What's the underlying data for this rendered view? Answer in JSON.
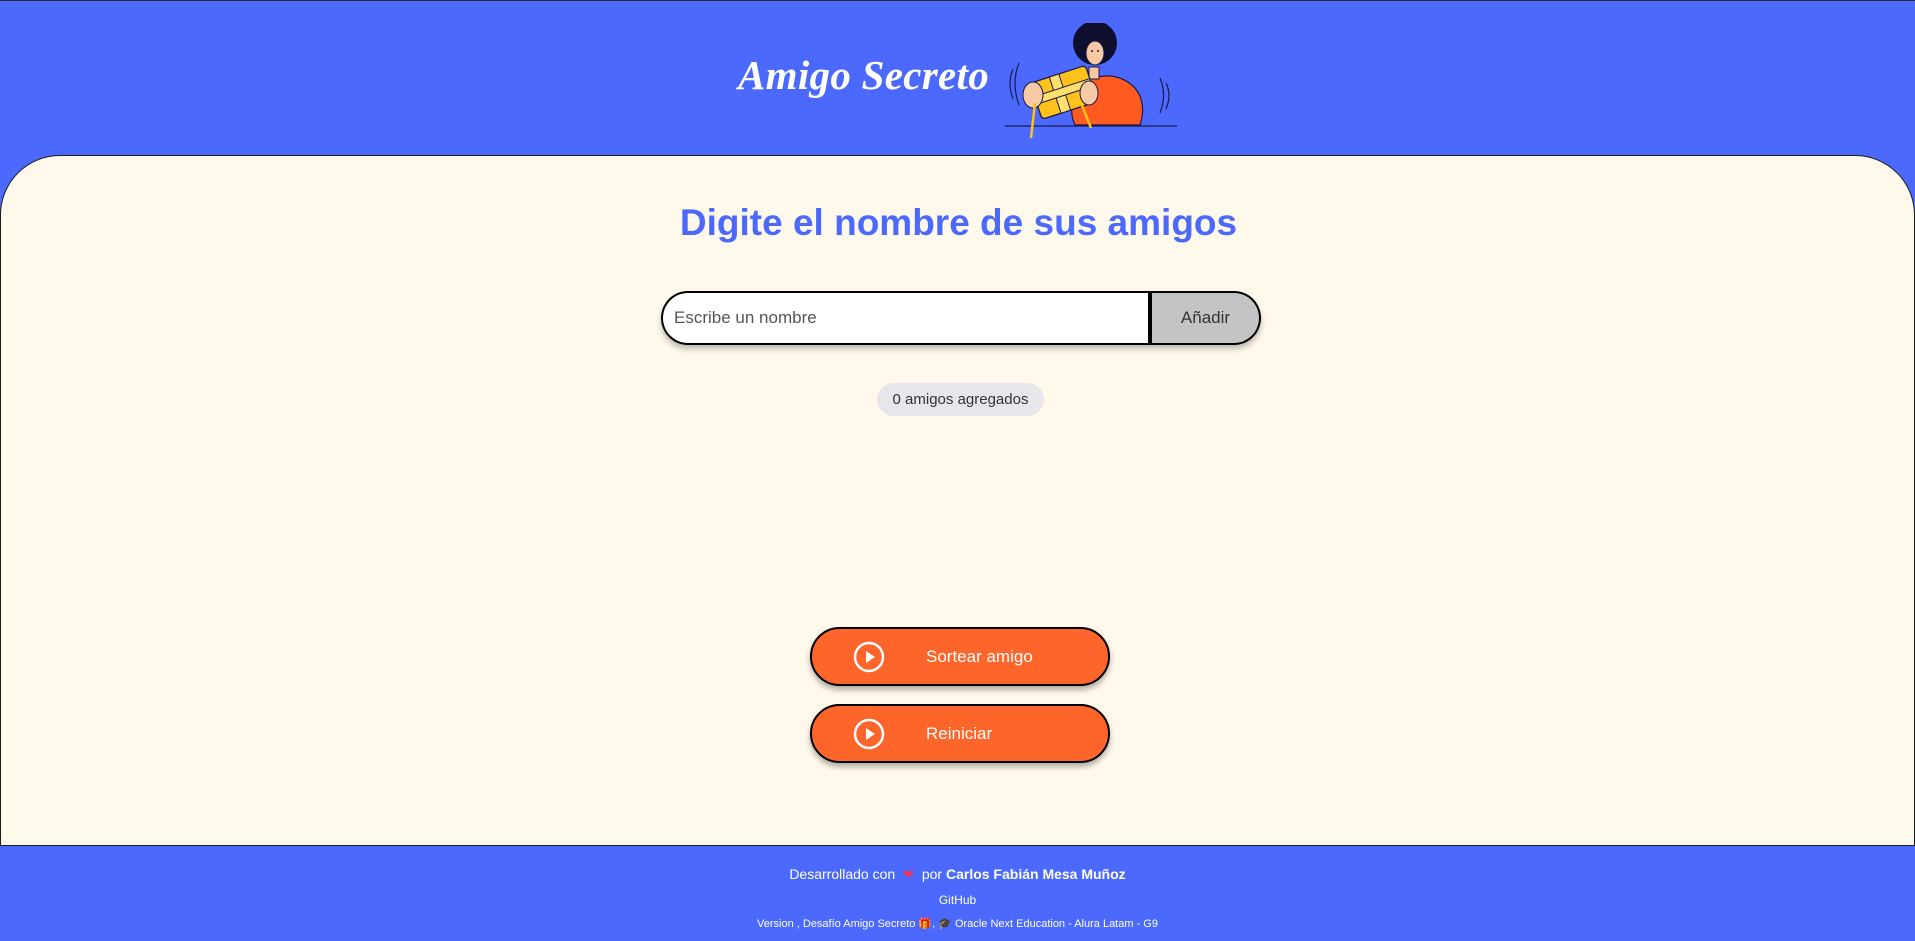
{
  "header": {
    "title": "Amigo Secreto",
    "illustration_icon": "person-holding-gift-illustration"
  },
  "main": {
    "heading": "Digite el nombre de sus amigos",
    "name_input": {
      "value": "",
      "placeholder": "Escribe un nombre"
    },
    "add_button_label": "Añadir",
    "friends_count_label": "0 amigos agregados",
    "draw_button": {
      "label": "Sortear amigo",
      "icon": "play-circle-icon"
    },
    "reset_button": {
      "label": "Reiniciar",
      "icon": "play-circle-icon"
    }
  },
  "footer": {
    "credit_prefix": "Desarrollado con",
    "credit_heart": "❤",
    "credit_by": "por",
    "author": "Carlos Fabián Mesa Muñoz",
    "github_link": "GitHub",
    "version_text": "Version , Desafío Amigo Secreto 🎁, 🎓 Oracle Next Education - Alura Latam - G9"
  },
  "colors": {
    "background_blue": "#4b69fd",
    "main_panel": "#fff9eb",
    "accent_orange": "#fe652b",
    "add_button_gray": "#c4c4c4",
    "badge_gray": "#e8e6ea"
  }
}
